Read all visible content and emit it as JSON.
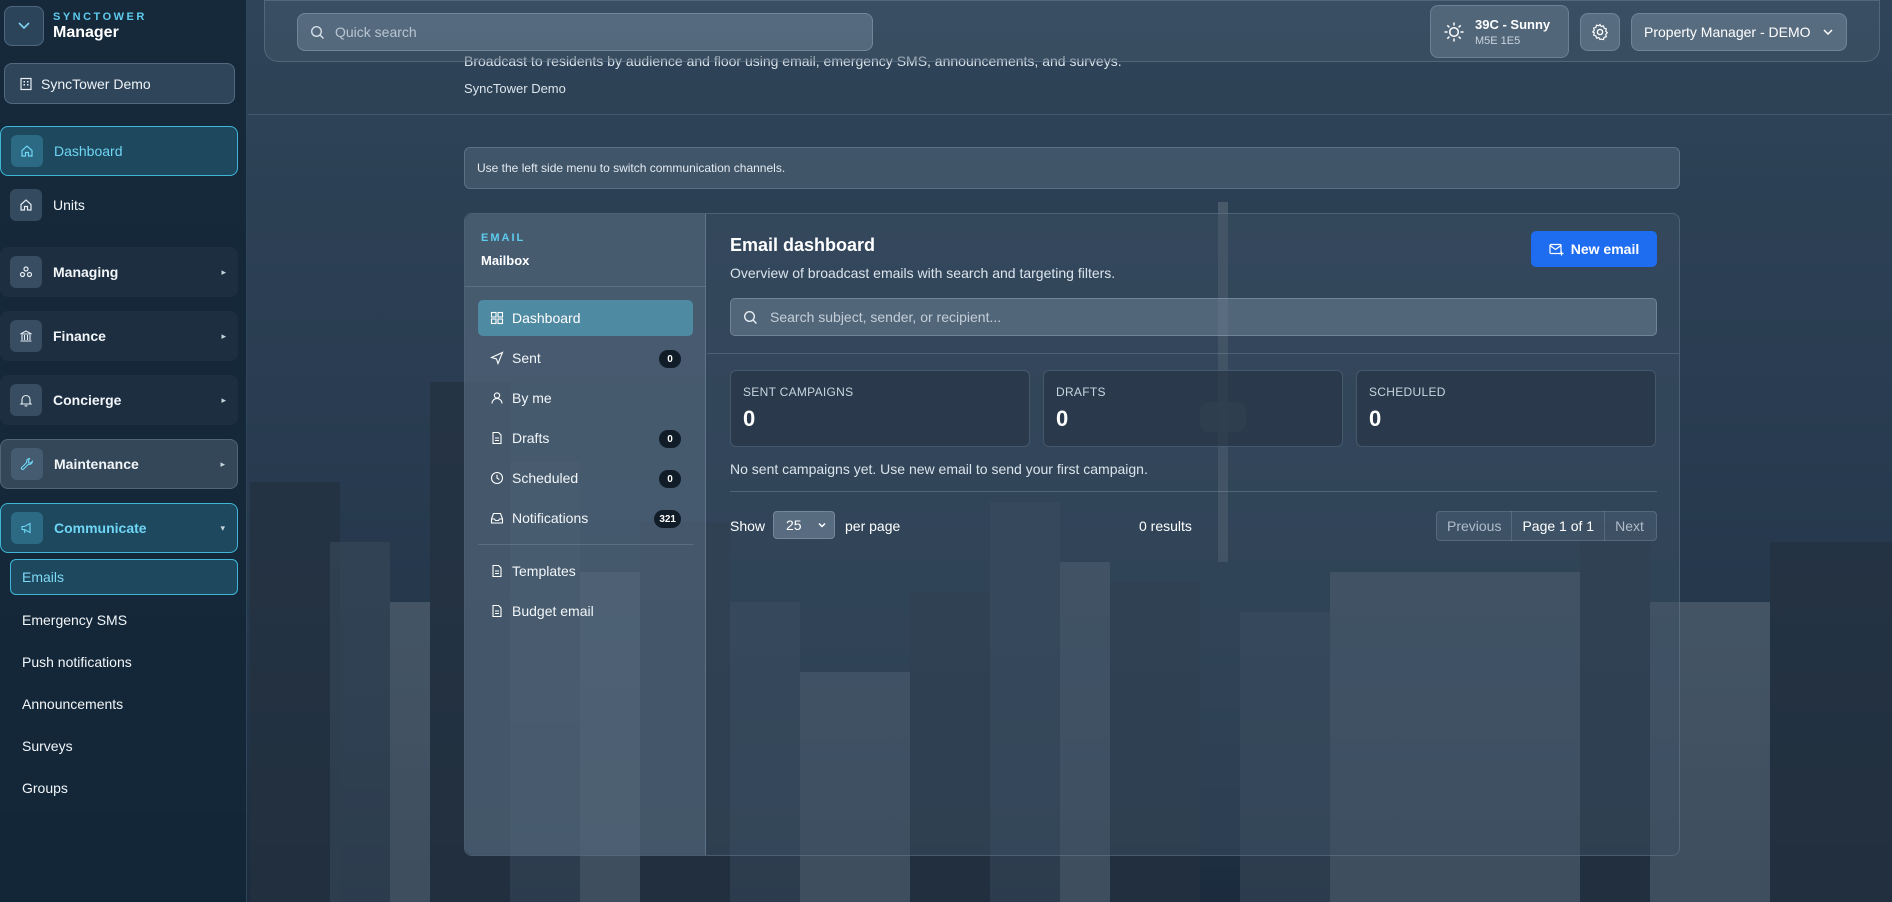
{
  "brand": {
    "sub": "SYNCTOWER",
    "main": "Manager",
    "logo_icon": "chevron-down-icon"
  },
  "org": {
    "label": "SyncTower Demo",
    "icon": "building-icon"
  },
  "nav": {
    "dashboard": "Dashboard",
    "units": "Units",
    "managing": "Managing",
    "finance": "Finance",
    "concierge": "Concierge",
    "maintenance": "Maintenance",
    "communicate": "Communicate",
    "caret_closed": "▸",
    "caret_open": "▾"
  },
  "communicate_sub": {
    "emails": "Emails",
    "emergency_sms": "Emergency SMS",
    "push": "Push notifications",
    "announcements": "Announcements",
    "surveys": "Surveys",
    "groups": "Groups"
  },
  "topbar": {
    "search_placeholder": "Quick search",
    "weather_main": "39C - Sunny",
    "weather_sub": "M5E 1E5",
    "role": "Property Manager - DEMO"
  },
  "page": {
    "description": "Broadcast to residents by audience and floor using email, emergency SMS, announcements, and surveys.",
    "org": "SyncTower Demo",
    "hint": "Use the left side menu to switch communication channels."
  },
  "mailbox": {
    "label": "EMAIL",
    "title": "Mailbox",
    "items": {
      "dashboard": "Dashboard",
      "sent": "Sent",
      "sent_count": "0",
      "byme": "By me",
      "drafts": "Drafts",
      "drafts_count": "0",
      "scheduled": "Scheduled",
      "scheduled_count": "0",
      "notifications": "Notifications",
      "notifications_count": "321",
      "templates": "Templates",
      "budget": "Budget email"
    }
  },
  "email_dashboard": {
    "title": "Email dashboard",
    "subtitle": "Overview of broadcast emails with search and targeting filters.",
    "new_button": "New email",
    "search_placeholder": "Search subject, sender, or recipient...",
    "stats": {
      "sent_label": "SENT CAMPAIGNS",
      "sent_value": "0",
      "drafts_label": "DRAFTS",
      "drafts_value": "0",
      "scheduled_label": "SCHEDULED",
      "scheduled_value": "0"
    },
    "empty": "No sent campaigns yet. Use new email to send your first campaign.",
    "show_label": "Show",
    "per_page_value": "25",
    "per_page_label": "per page",
    "results": "0 results",
    "prev": "Previous",
    "page": "Page 1 of 1",
    "next": "Next"
  },
  "colors": {
    "accent": "#3fb6d8",
    "primary_button": "#1e6cf0",
    "active_mailbox": "#4f8aa3"
  }
}
